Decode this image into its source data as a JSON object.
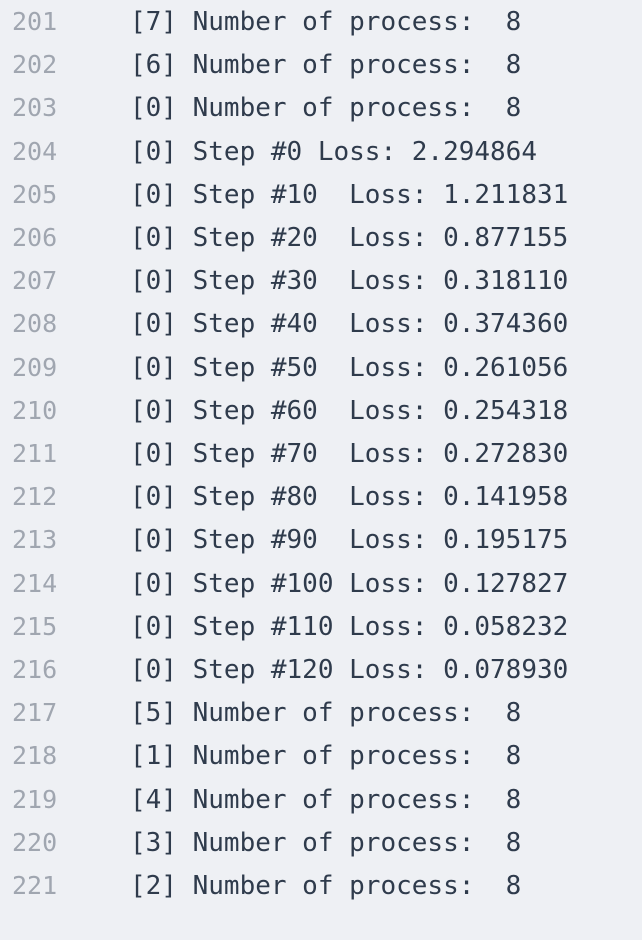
{
  "colors": {
    "background": "#eef0f4",
    "line_number": "#a0a6b0",
    "code_text": "#2f3b4c"
  },
  "lines": [
    {
      "num": "201",
      "text": "[7] Number of process:  8"
    },
    {
      "num": "202",
      "text": "[6] Number of process:  8"
    },
    {
      "num": "203",
      "text": "[0] Number of process:  8"
    },
    {
      "num": "204",
      "text": "[0] Step #0 Loss: 2.294864"
    },
    {
      "num": "205",
      "text": "[0] Step #10  Loss: 1.211831"
    },
    {
      "num": "206",
      "text": "[0] Step #20  Loss: 0.877155"
    },
    {
      "num": "207",
      "text": "[0] Step #30  Loss: 0.318110"
    },
    {
      "num": "208",
      "text": "[0] Step #40  Loss: 0.374360"
    },
    {
      "num": "209",
      "text": "[0] Step #50  Loss: 0.261056"
    },
    {
      "num": "210",
      "text": "[0] Step #60  Loss: 0.254318"
    },
    {
      "num": "211",
      "text": "[0] Step #70  Loss: 0.272830"
    },
    {
      "num": "212",
      "text": "[0] Step #80  Loss: 0.141958"
    },
    {
      "num": "213",
      "text": "[0] Step #90  Loss: 0.195175"
    },
    {
      "num": "214",
      "text": "[0] Step #100 Loss: 0.127827"
    },
    {
      "num": "215",
      "text": "[0] Step #110 Loss: 0.058232"
    },
    {
      "num": "216",
      "text": "[0] Step #120 Loss: 0.078930"
    },
    {
      "num": "217",
      "text": "[5] Number of process:  8"
    },
    {
      "num": "218",
      "text": "[1] Number of process:  8"
    },
    {
      "num": "219",
      "text": "[4] Number of process:  8"
    },
    {
      "num": "220",
      "text": "[3] Number of process:  8"
    },
    {
      "num": "221",
      "text": "[2] Number of process:  8"
    }
  ]
}
